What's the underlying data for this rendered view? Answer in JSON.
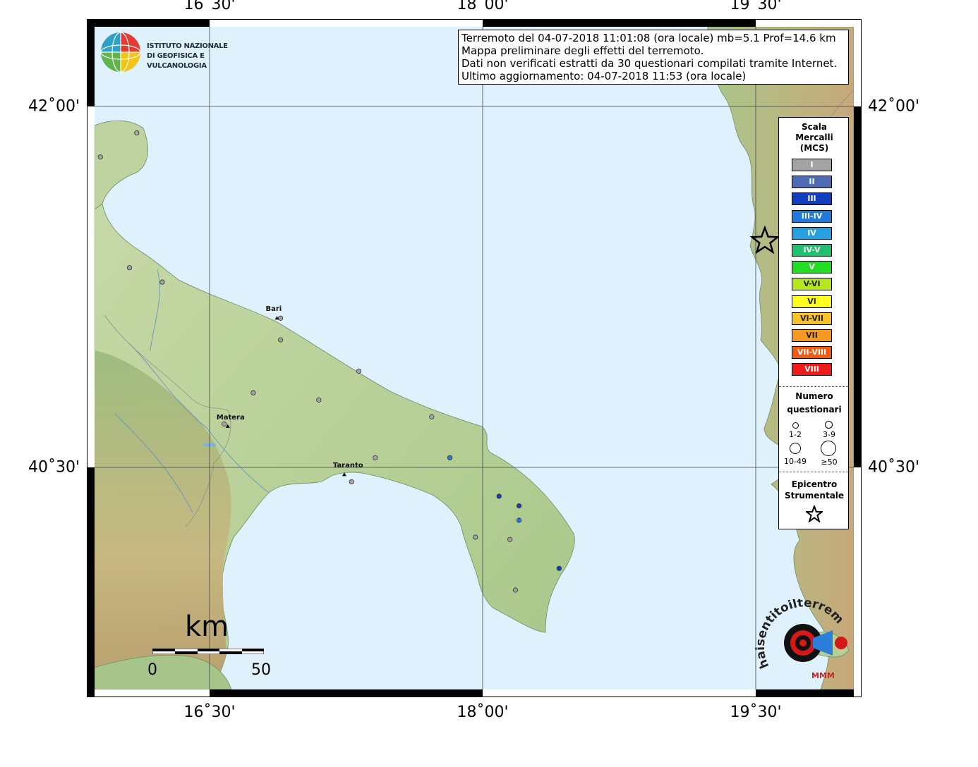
{
  "map": {
    "grid": {
      "longitude_labels": [
        {
          "lon": 16.5,
          "label": "16˚30'"
        },
        {
          "lon": 18.0,
          "label": "18˚00'"
        },
        {
          "lon": 19.5,
          "label": "19˚30'"
        }
      ],
      "latitude_labels": [
        {
          "lat": 42.0,
          "label": "42˚00'"
        },
        {
          "lat": 40.5,
          "label": "40˚30'"
        }
      ]
    },
    "cities": [
      {
        "name": "Bari",
        "lon": 16.87,
        "lat": 41.12
      },
      {
        "name": "Matera",
        "lon": 16.6,
        "lat": 40.67
      },
      {
        "name": "Taranto",
        "lon": 17.24,
        "lat": 40.47
      }
    ],
    "epicenter": {
      "lon": 19.55,
      "lat": 41.44
    },
    "observations": [
      {
        "lon": 16.1,
        "lat": 41.89,
        "intensity": "I"
      },
      {
        "lon": 15.9,
        "lat": 41.79,
        "intensity": "I"
      },
      {
        "lon": 16.06,
        "lat": 41.33,
        "intensity": "I"
      },
      {
        "lon": 16.24,
        "lat": 41.27,
        "intensity": "I"
      },
      {
        "lon": 16.89,
        "lat": 41.12,
        "intensity": "I"
      },
      {
        "lon": 16.89,
        "lat": 41.03,
        "intensity": "I"
      },
      {
        "lon": 17.32,
        "lat": 40.9,
        "intensity": "I"
      },
      {
        "lon": 16.74,
        "lat": 40.81,
        "intensity": "I"
      },
      {
        "lon": 17.1,
        "lat": 40.78,
        "intensity": "I"
      },
      {
        "lon": 17.72,
        "lat": 40.71,
        "intensity": "I"
      },
      {
        "lon": 17.41,
        "lat": 40.54,
        "intensity": "I"
      },
      {
        "lon": 17.82,
        "lat": 40.54,
        "intensity": "III-IV"
      },
      {
        "lon": 17.28,
        "lat": 40.44,
        "intensity": "I"
      },
      {
        "lon": 18.09,
        "lat": 40.38,
        "intensity": "III"
      },
      {
        "lon": 18.2,
        "lat": 40.34,
        "intensity": "III"
      },
      {
        "lon": 18.2,
        "lat": 40.28,
        "intensity": "III-IV"
      },
      {
        "lon": 17.96,
        "lat": 40.21,
        "intensity": "I"
      },
      {
        "lon": 18.15,
        "lat": 40.2,
        "intensity": "I"
      },
      {
        "lon": 18.42,
        "lat": 40.08,
        "intensity": "III"
      },
      {
        "lon": 18.18,
        "lat": 39.99,
        "intensity": "I"
      },
      {
        "lon": 16.58,
        "lat": 40.68,
        "intensity": "I"
      }
    ]
  },
  "info": {
    "line1": "Terremoto del 04-07-2018 11:01:08 (ora locale) mb=5.1 Prof=14.6 km",
    "line2": "Mappa preliminare degli effetti del terremoto.",
    "line3": "Dati non verificati estratti da 30 questionari compilati tramite Internet.",
    "line4": "Ultimo aggiornamento: 04-07-2018 11:53 (ora locale)"
  },
  "ingv": {
    "line1": "ISTITUTO NAZIONALE",
    "line2": "DI GEOFISICA E VULCANOLOGIA"
  },
  "legend": {
    "title_line1": "Scala",
    "title_line2": "Mercalli",
    "title_line3": "(MCS)",
    "intensities": [
      {
        "label": "I",
        "color": "#a3a3a3"
      },
      {
        "label": "II",
        "color": "#4e6bb3"
      },
      {
        "label": "III",
        "color": "#1040c0"
      },
      {
        "label": "III-IV",
        "color": "#1f7ad8"
      },
      {
        "label": "IV",
        "color": "#27a0e0"
      },
      {
        "label": "IV-V",
        "color": "#1fc070"
      },
      {
        "label": "V",
        "color": "#22dd22"
      },
      {
        "label": "V-VI",
        "color": "#b8e61e"
      },
      {
        "label": "VI",
        "color": "#ffff22"
      },
      {
        "label": "VI-VII",
        "color": "#f7c12a"
      },
      {
        "label": "VII",
        "color": "#f49a22"
      },
      {
        "label": "VII-VIII",
        "color": "#f25a14"
      },
      {
        "label": "VIII",
        "color": "#ee1b1b"
      }
    ],
    "count_title_line1": "Numero",
    "count_title_line2": "questionari",
    "count_classes": [
      "1-2",
      "3-9",
      "10-49",
      "≥50"
    ],
    "epicenter_line1": "Epicentro",
    "epicenter_line2": "Strumentale"
  },
  "scale": {
    "unit": "km",
    "start": "0",
    "end": "50"
  },
  "haisentito": {
    "text": "haisentitoilterremoto.it",
    "sub": "MMM"
  }
}
